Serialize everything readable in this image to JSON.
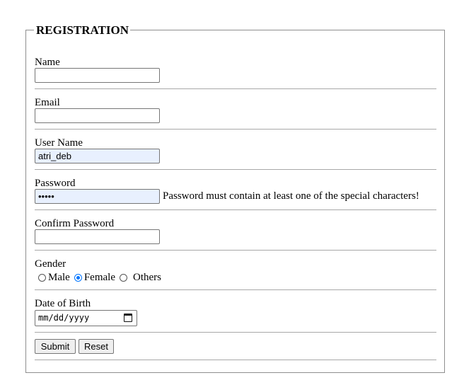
{
  "form": {
    "legend": "REGISTRATION",
    "name": {
      "label": "Name",
      "value": ""
    },
    "email": {
      "label": "Email",
      "value": ""
    },
    "username": {
      "label": "User Name",
      "value": "atri_deb"
    },
    "password": {
      "label": "Password",
      "value": "•••••",
      "note": "Password must contain at least one of the special characters!"
    },
    "confirm_password": {
      "label": "Confirm Password",
      "value": ""
    },
    "gender": {
      "label": "Gender",
      "options": [
        "Male",
        "Female",
        "Others"
      ],
      "selected": "Female"
    },
    "dob": {
      "label": "Date of Birth",
      "placeholder": "mm/dd/yyyy"
    },
    "buttons": {
      "submit": "Submit",
      "reset": "Reset"
    }
  },
  "colors": {
    "autofill_bg": "#e8f0fe",
    "radio_accent": "#0075ff",
    "border": "#767676"
  }
}
